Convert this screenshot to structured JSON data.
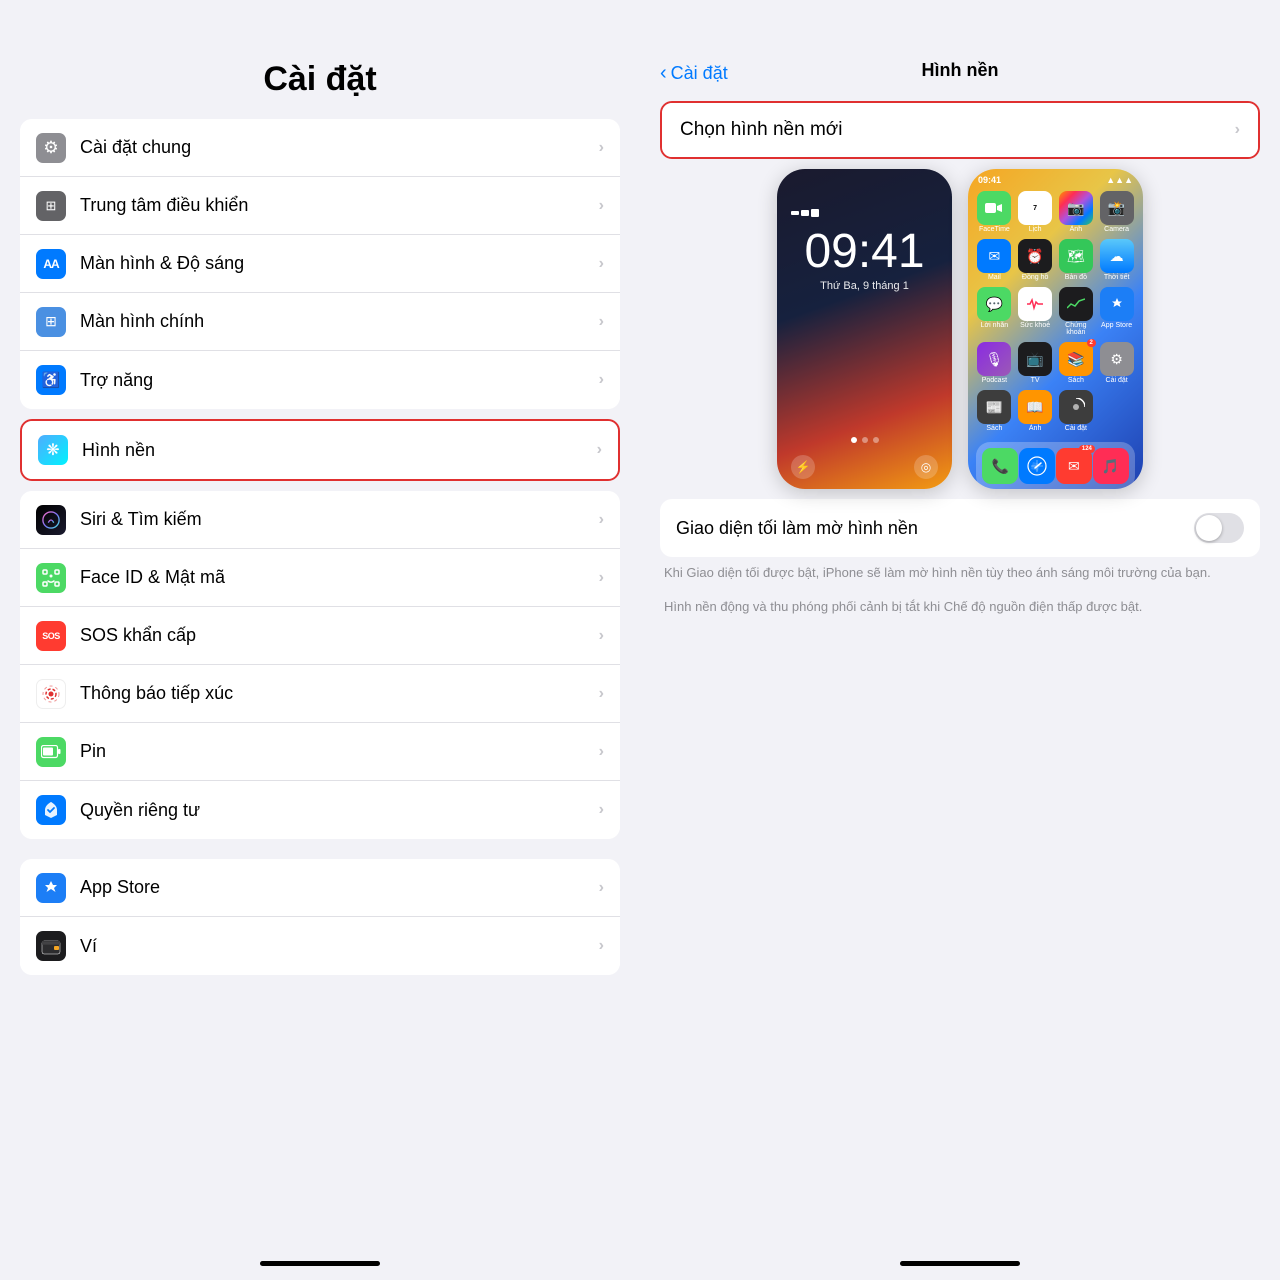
{
  "left": {
    "header": "Cài đặt",
    "groups": [
      {
        "id": "general-group",
        "items": [
          {
            "id": "cai-dat-chung",
            "label": "Cài đặt chung",
            "iconType": "gear",
            "iconColor": "gray"
          },
          {
            "id": "trung-tam-dieu-khien",
            "label": "Trung tâm điều khiển",
            "iconType": "toggle",
            "iconColor": "gray2"
          },
          {
            "id": "man-hinh-do-sang",
            "label": "Màn hình & Độ sáng",
            "iconType": "AA",
            "iconColor": "blue"
          },
          {
            "id": "man-hinh-chinh",
            "label": "Màn hình chính",
            "iconType": "grid",
            "iconColor": "blue2"
          },
          {
            "id": "tro-nang",
            "label": "Trợ năng",
            "iconType": "person-circle",
            "iconColor": "blue"
          }
        ]
      },
      {
        "id": "hinh-nen-group",
        "highlighted": true,
        "items": [
          {
            "id": "hinh-nen",
            "label": "Hình nền",
            "iconType": "flower",
            "iconColor": "blue"
          }
        ]
      },
      {
        "id": "siri-group",
        "items": [
          {
            "id": "siri-tim-kiem",
            "label": "Siri & Tìm kiếm",
            "iconType": "siri",
            "iconColor": "dark"
          },
          {
            "id": "face-id",
            "label": "Face ID & Mật mã",
            "iconType": "face-id",
            "iconColor": "green2"
          },
          {
            "id": "sos",
            "label": "SOS khẩn cấp",
            "iconType": "SOS",
            "iconColor": "red"
          },
          {
            "id": "thong-bao-tiep-xuc",
            "label": "Thông báo tiếp xúc",
            "iconType": "dots",
            "iconColor": "red-dots"
          },
          {
            "id": "pin",
            "label": "Pin",
            "iconType": "battery",
            "iconColor": "green-battery"
          },
          {
            "id": "quyen-rieng-tu",
            "label": "Quyền riêng tư",
            "iconType": "hand",
            "iconColor": "blue-hand"
          }
        ]
      },
      {
        "id": "store-group",
        "items": [
          {
            "id": "app-store",
            "label": "App Store",
            "iconType": "appstore",
            "iconColor": "appstore"
          },
          {
            "id": "vi",
            "label": "Ví",
            "iconType": "wallet",
            "iconColor": "wallet"
          }
        ]
      }
    ],
    "chevron": "›",
    "home_indicator": ""
  },
  "right": {
    "back_label": "Cài đặt",
    "title": "Hình nền",
    "choose_label": "Chọn hình nền mới",
    "chevron": "›",
    "lock_time": "09:41",
    "lock_date": "Thứ Ba, 9 tháng 1",
    "toggle_label": "Giao diện tối làm mờ hình nền",
    "toggle_on": false,
    "desc1": "Khi Giao diện tối được bật, iPhone sẽ làm mờ hình nền tùy theo ánh sáng môi trường của bạn.",
    "desc2": "Hình nền động và thu phóng phối cảnh bị tắt khi Chế độ nguồn điện thấp được bật.",
    "home_indicator": ""
  }
}
